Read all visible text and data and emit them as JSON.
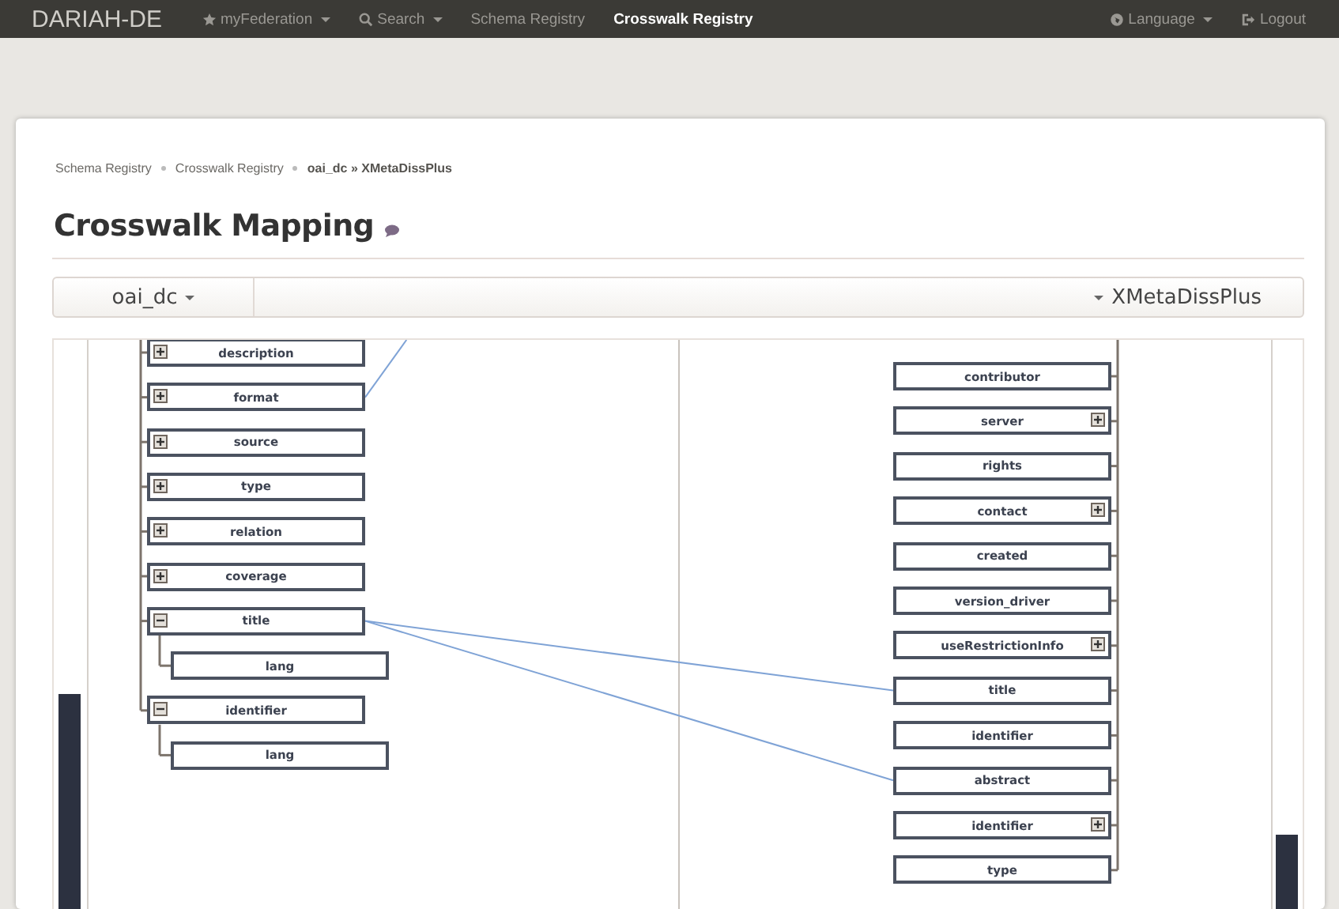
{
  "navbar": {
    "brand": "DARIAH-DE",
    "items": [
      {
        "label": "myFederation",
        "kind": "starred-menu",
        "selected": false
      },
      {
        "label": "Search",
        "kind": "search-menu",
        "selected": false
      },
      {
        "label": "Schema Registry",
        "kind": "link",
        "selected": false
      },
      {
        "label": "Crosswalk Registry",
        "kind": "link",
        "selected": true
      }
    ],
    "right_items": [
      {
        "label": "Language",
        "kind": "language-menu"
      },
      {
        "label": "Logout",
        "kind": "logout"
      }
    ]
  },
  "breadcrumb": [
    {
      "label": "Schema Registry",
      "current": false
    },
    {
      "label": "Crosswalk Registry",
      "current": false
    },
    {
      "label": "oai_dc » XMetaDissPlus",
      "current": true
    }
  ],
  "page_title": "Crosswalk Mapping",
  "toolbar": {
    "source_schema": "oai_dc",
    "target_schema": "XMetaDissPlus"
  },
  "mapping": {
    "left_tree": [
      {
        "label": "description",
        "expanded": false
      },
      {
        "label": "format",
        "expanded": false,
        "mapped": true,
        "target_visible": false
      },
      {
        "label": "source",
        "expanded": false
      },
      {
        "label": "type",
        "expanded": false
      },
      {
        "label": "relation",
        "expanded": false
      },
      {
        "label": "coverage",
        "expanded": false
      },
      {
        "label": "title",
        "expanded": true,
        "mapped": true,
        "target_visible": true,
        "children": [
          {
            "label": "lang"
          }
        ]
      },
      {
        "label": "identifier",
        "expanded": true,
        "children": [
          {
            "label": "lang"
          }
        ]
      }
    ],
    "right_tree": [
      {
        "label": "contributor"
      },
      {
        "label": "server",
        "expanded": false
      },
      {
        "label": "rights"
      },
      {
        "label": "contact",
        "expanded": false
      },
      {
        "label": "created"
      },
      {
        "label": "version_driver"
      },
      {
        "label": "useRestrictionInfo",
        "expanded": false
      },
      {
        "label": "title",
        "mapped": true
      },
      {
        "label": "identifier"
      },
      {
        "label": "abstract",
        "mapped": true
      },
      {
        "label": "identifier",
        "expanded": false
      },
      {
        "label": "type"
      }
    ]
  }
}
